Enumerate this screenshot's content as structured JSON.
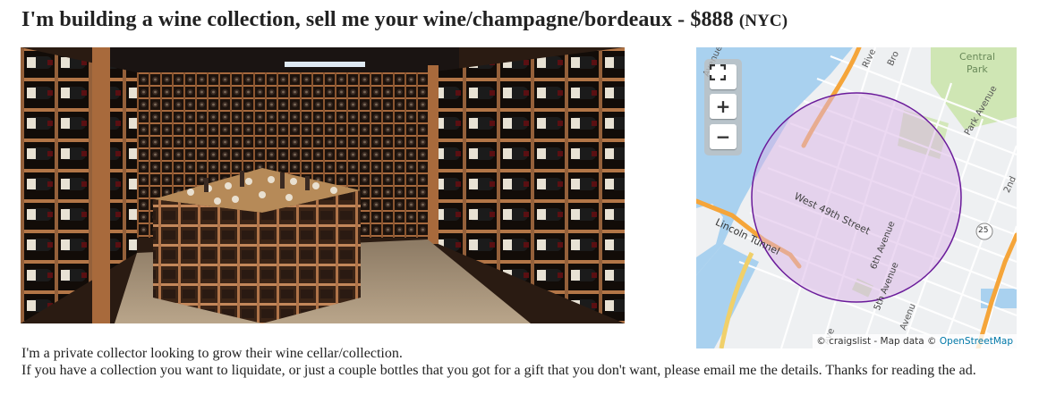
{
  "posting": {
    "title": "I'm building a wine collection, sell me your wine/champagne/bordeaux - $888",
    "location": "(NYC)",
    "body_lines": [
      "I'm a private collector looking to grow their wine cellar/collection.",
      "If you have a collection you want to liquidate, or just a couple bottles that you got for a gift that you don't want, please email me the details. Thanks for reading the ad."
    ]
  },
  "map": {
    "controls": {
      "fullscreen_icon": "fullscreen-icon",
      "zoom_in_label": "+",
      "zoom_out_label": "−"
    },
    "labels": {
      "central_park_1": "Central",
      "central_park_2": "Park",
      "park_avenue": "Park Avenue",
      "west_49th": "West 49th Street",
      "sixth_avenue": "6th Avenue",
      "fifth_avenue": "5th Avenue",
      "lincoln_tunnel": "Lincoln Tunnel",
      "route_badge": "25",
      "avenue_partial": "Avenue",
      "riverside_partial": "Rive",
      "broadway_partial": "Bro",
      "second_partial": "2nd",
      "avenue_partial_2": "Avenu",
      "avenue_partial_3": "Ave"
    },
    "attribution": {
      "prefix": "© craigslist - Map data ©",
      "link": "OpenStreetMap"
    },
    "colors": {
      "water": "#a9d1ef",
      "park": "#cfe6b4",
      "radius_stroke": "#6a1b9a",
      "radius_fill": "#d9b3e6",
      "highway": "#f5a53a"
    }
  }
}
